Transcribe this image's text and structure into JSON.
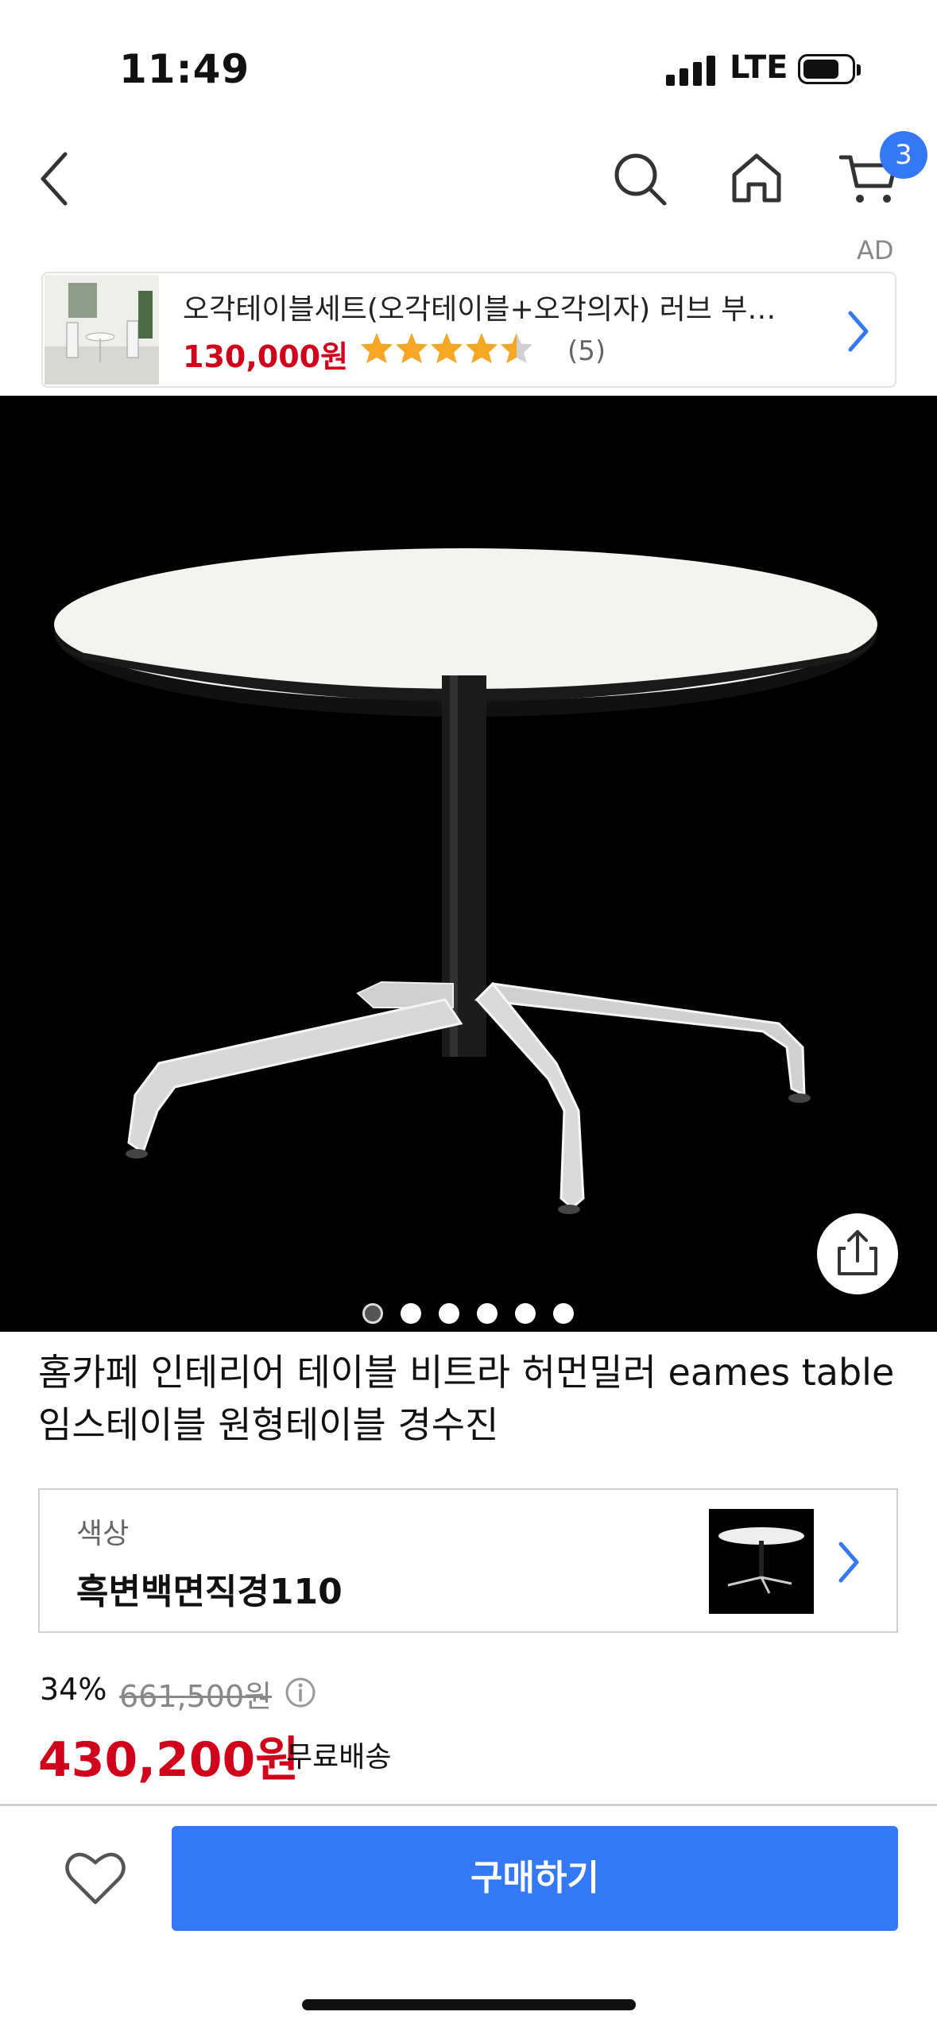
{
  "status_bar": {
    "time": "11:49",
    "network": "LTE",
    "signal": "signal-bars-icon",
    "battery": "battery-icon"
  },
  "nav": {
    "back": "back-chevron-icon",
    "search": "search-icon",
    "home": "home-icon",
    "cart": "cart-icon",
    "cart_count": "3"
  },
  "ad": {
    "label": "AD",
    "title": "오각테이블세트(오각테이블+오각의자) 러브 부…",
    "price": "130,000원",
    "rating": 4.5,
    "review_count": "(5)"
  },
  "gallery": {
    "total_images": 6,
    "active_index": 0,
    "share": "share-icon"
  },
  "product": {
    "title": "홈카페 인테리어 테이블 비트라 허먼밀러 eames table 임스테이블 원형테이블 경수진",
    "option_label": "색상",
    "option_value": "흑변백면직경110",
    "discount": "34%",
    "original_price": "661,500원",
    "price": "430,200원",
    "shipping": "무료배송"
  },
  "bottom_bar": {
    "wishlist": "heart-icon",
    "buy_label": "구매하기"
  },
  "colors": {
    "accent": "#3478f6",
    "price_red": "#d0021b",
    "star": "#f5a623"
  }
}
